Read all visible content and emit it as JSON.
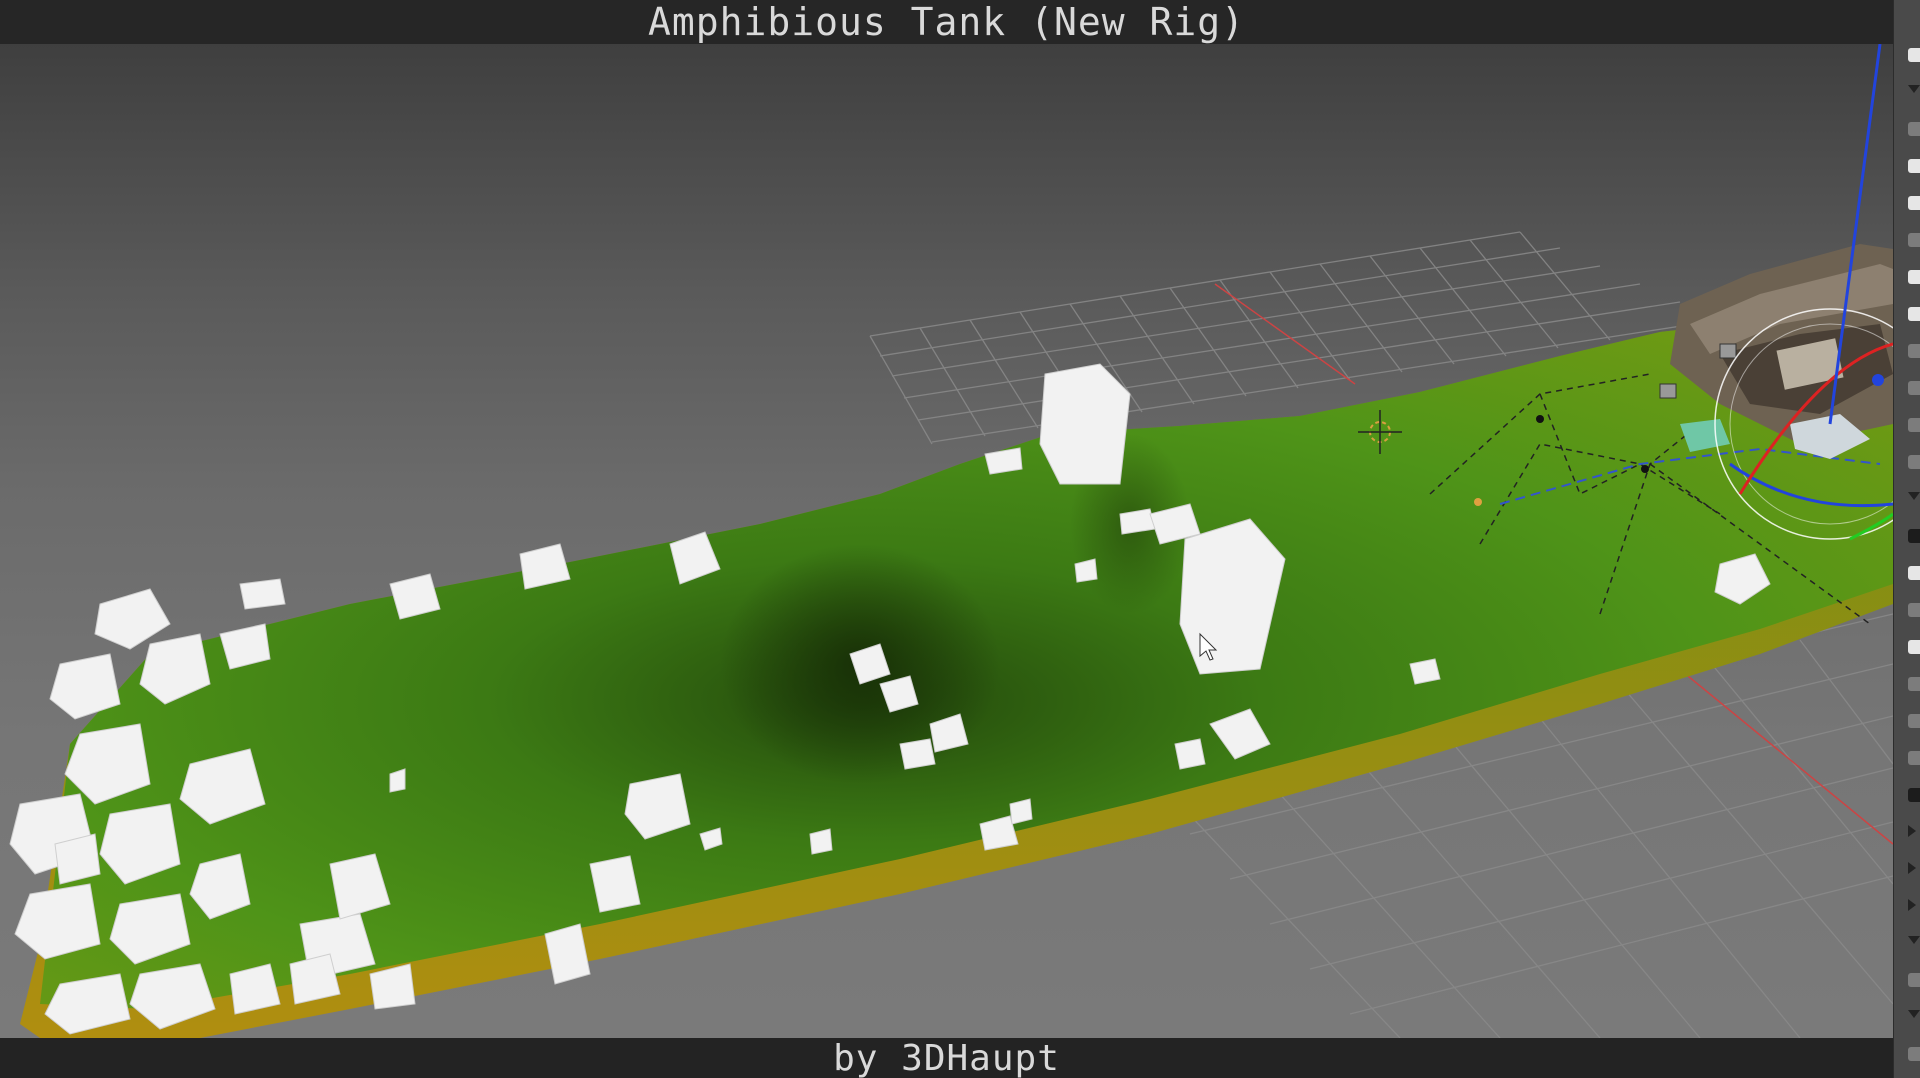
{
  "window": {
    "title": "Amphibious Tank (New Rig)"
  },
  "footer": {
    "credit": "by 3DHaupt"
  },
  "viewport": {
    "background_top": "#3f3f3f",
    "background_bottom": "#7a7a7a",
    "terrain_color": "#4a8c1a",
    "terrain_edge_color": "#a08c10",
    "rock_color": "#f0f0f0",
    "grid_color": "#8c8c8c",
    "axis_x_color": "#c04040"
  },
  "properties_strip": {
    "items": [
      {
        "kind": "check"
      },
      {
        "kind": "tri"
      },
      {
        "kind": "box"
      },
      {
        "kind": "check"
      },
      {
        "kind": "check"
      },
      {
        "kind": "box"
      },
      {
        "kind": "check"
      },
      {
        "kind": "check"
      },
      {
        "kind": "box"
      },
      {
        "kind": "box"
      },
      {
        "kind": "box"
      },
      {
        "kind": "box"
      },
      {
        "kind": "tri"
      },
      {
        "kind": "dark"
      },
      {
        "kind": "check"
      },
      {
        "kind": "box"
      },
      {
        "kind": "check"
      },
      {
        "kind": "box"
      },
      {
        "kind": "box"
      },
      {
        "kind": "box"
      },
      {
        "kind": "dark"
      },
      {
        "kind": "tri-r"
      },
      {
        "kind": "tri-r"
      },
      {
        "kind": "tri-r"
      },
      {
        "kind": "tri"
      },
      {
        "kind": "box"
      },
      {
        "kind": "tri"
      },
      {
        "kind": "box"
      }
    ]
  },
  "icons": {
    "cursor": "3d-cursor-icon",
    "mouse": "mouse-pointer-icon",
    "tank": "amphibious-tank-model"
  }
}
